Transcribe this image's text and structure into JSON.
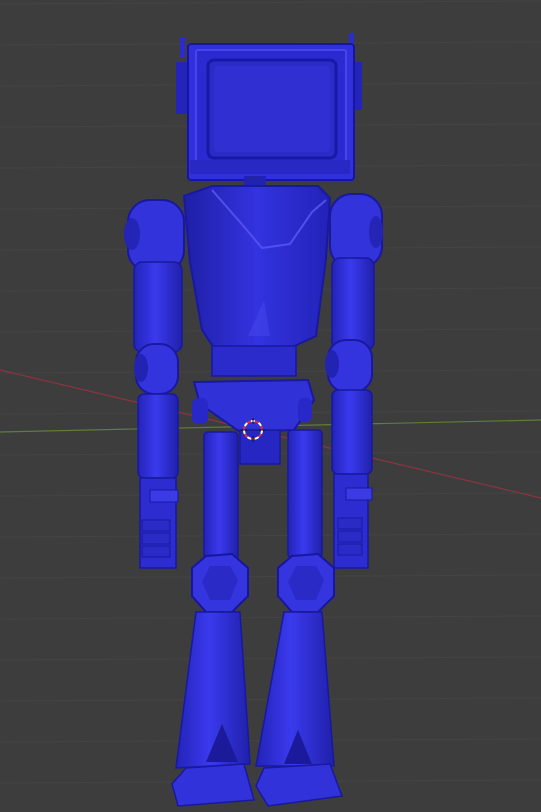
{
  "viewport": {
    "background": "#3d3d3d",
    "grid_color": "#444444",
    "x_axis_color": "#9a3a45",
    "y_axis_color": "#6a8a3a"
  },
  "model": {
    "base_color": "#2e2ed8",
    "shadow_color": "#1f1fa6",
    "highlight_color": "#5a5af0",
    "edge_color": "#1616a0"
  },
  "origin": {
    "icon": "3d-cursor-icon",
    "ring_color_a": "#e03030",
    "ring_color_b": "#ffffff"
  }
}
